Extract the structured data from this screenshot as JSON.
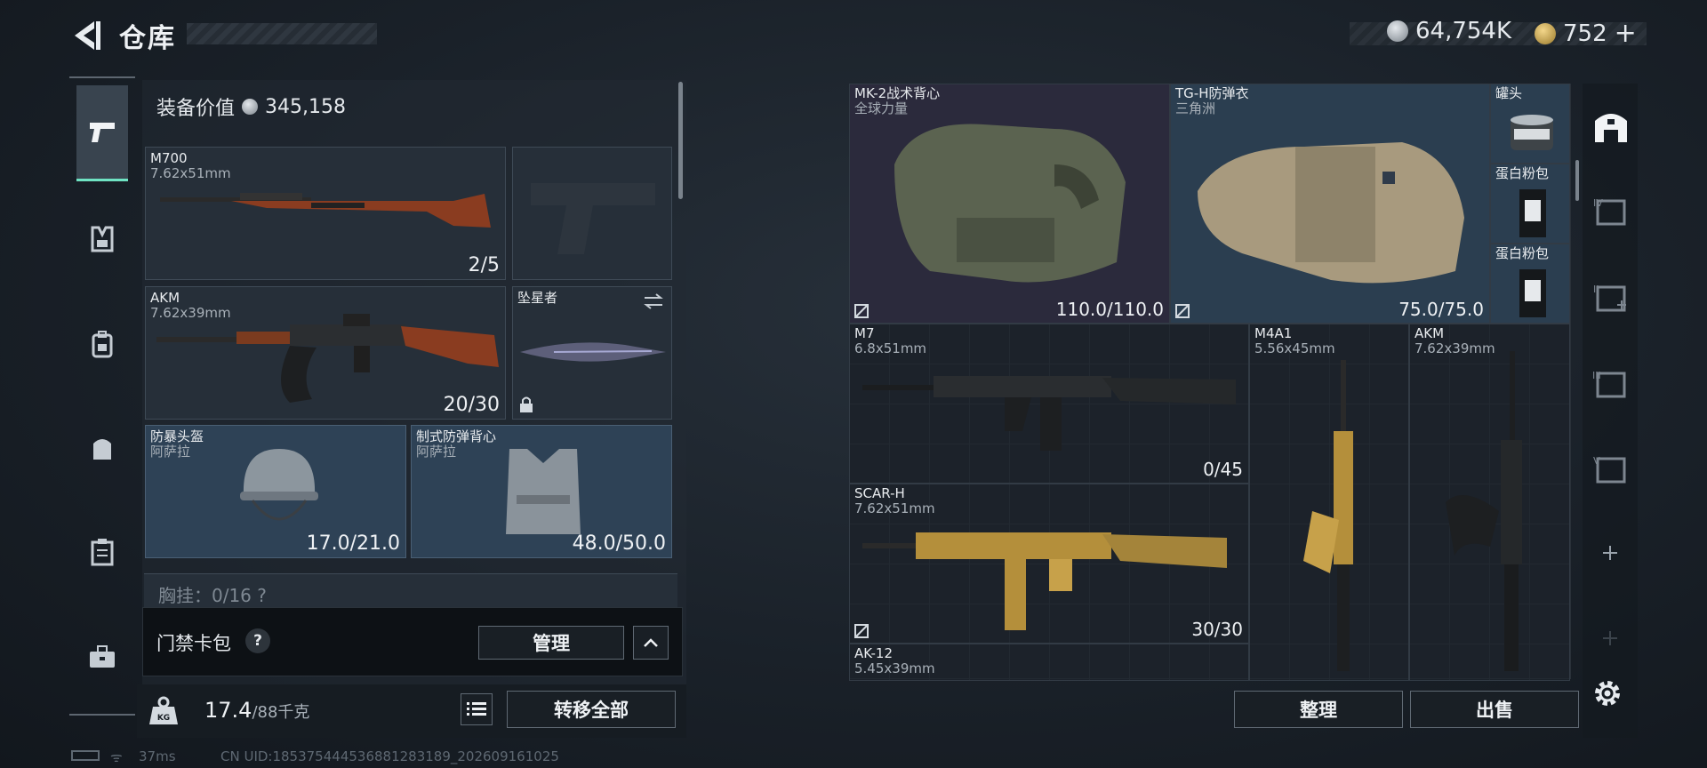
{
  "header": {
    "title": "仓库"
  },
  "currency": {
    "silver_amount": "64,754K",
    "gold_amount": "752",
    "plus": "+"
  },
  "left_nav": {
    "items": [
      "pistol-icon",
      "vest-icon",
      "backpack-icon",
      "pack-icon",
      "clipboard-icon",
      "toolbox-icon"
    ],
    "accent": "#6fe3c3"
  },
  "loadout": {
    "equip_label": "装备价值",
    "equip_value": "345,158",
    "primary1": {
      "name": "M700",
      "caliber": "7.62x51mm",
      "ammo": "2/5"
    },
    "primary2": {
      "name": "AKM",
      "caliber": "7.62x39mm",
      "ammo": "20/30"
    },
    "melee": {
      "name": "坠星者"
    },
    "helmet": {
      "name": "防暴头盔",
      "brand": "阿萨拉",
      "durability": "17.0/21.0"
    },
    "armor": {
      "name": "制式防弹背心",
      "brand": "阿萨拉",
      "durability": "48.0/50.0"
    },
    "chest_rig": "胸挂：0/16   ?"
  },
  "access": {
    "label": "门禁卡包",
    "help": "?",
    "manage": "管理"
  },
  "weight": {
    "current": "17.4",
    "max": "/88千克",
    "kg_badge": "KG"
  },
  "transfer_all": "转移全部",
  "status": {
    "ping": "37ms",
    "uid": "CN UID:185375444536881283189_202609161025"
  },
  "stash": {
    "vest1": {
      "name": "MK-2战术背心",
      "brand": "全球力量",
      "durability": "110.0/110.0"
    },
    "vest2": {
      "name": "TG-H防弹衣",
      "brand": "三角洲",
      "durability": "75.0/75.0"
    },
    "can": {
      "name": "罐头"
    },
    "protein1": {
      "name": "蛋白粉包"
    },
    "protein2": {
      "name": "蛋白粉包"
    },
    "m7": {
      "name": "M7",
      "caliber": "6.8x51mm",
      "ammo": "0/45"
    },
    "m4a1": {
      "name": "M4A1",
      "caliber": "5.56x45mm"
    },
    "akm": {
      "name": "AKM",
      "caliber": "7.62x39mm"
    },
    "scar": {
      "name": "SCAR-H",
      "caliber": "7.62x51mm",
      "ammo": "30/30"
    },
    "ak12": {
      "name": "AK-12",
      "caliber": "5.45x39mm"
    }
  },
  "actions": {
    "sort": "整理",
    "sell": "出售"
  },
  "right_nav": {
    "tiers": [
      "IV",
      "II",
      "III",
      "V"
    ]
  }
}
